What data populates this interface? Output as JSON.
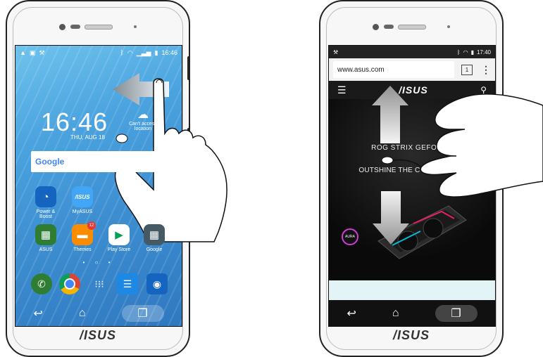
{
  "left_phone": {
    "brand": "/ISUS",
    "status_time": "16:46",
    "clock": "16:46",
    "date": "THU, AUG 18",
    "weather_text": "Can't access location",
    "search_label": "Google",
    "apps": [
      {
        "label": "Power & Boost",
        "icon": "speedometer-icon",
        "color": "#1565c0"
      },
      {
        "label": "MyASUS",
        "icon": "asus-icon",
        "color": "#42a5f5"
      },
      {
        "label": "ASUS",
        "icon": "folder-icon",
        "color": "#2e7d32"
      },
      {
        "label": "Themes",
        "icon": "paint-roller-icon",
        "color": "#fb8c00",
        "badge": "12"
      },
      {
        "label": "Play Store",
        "icon": "play-store-icon",
        "color": "#ffffff"
      },
      {
        "label": "Google",
        "icon": "folder-icon",
        "color": "#455a64"
      }
    ],
    "dock": [
      {
        "icon": "phone-icon",
        "color": "#2e7d32"
      },
      {
        "icon": "chrome-icon",
        "color": "#ffffff"
      },
      {
        "icon": "app-drawer-icon",
        "color": "transparent"
      },
      {
        "icon": "messages-icon",
        "color": "#1e88e5"
      },
      {
        "icon": "camera-icon",
        "color": "#1565c0"
      }
    ]
  },
  "right_phone": {
    "brand": "/ISUS",
    "status_time": "17:40",
    "url": "www.asus.com",
    "tab_count": "1",
    "site_logo": "/ISUS",
    "hero_line1": "ROG STRIX GEFORCE",
    "hero_line2": "OUTSHINE THE COMPETITION",
    "aura_label": "AURA"
  },
  "colors": {
    "home_accent": "#3d8ed1",
    "browser_dark": "#111111"
  }
}
